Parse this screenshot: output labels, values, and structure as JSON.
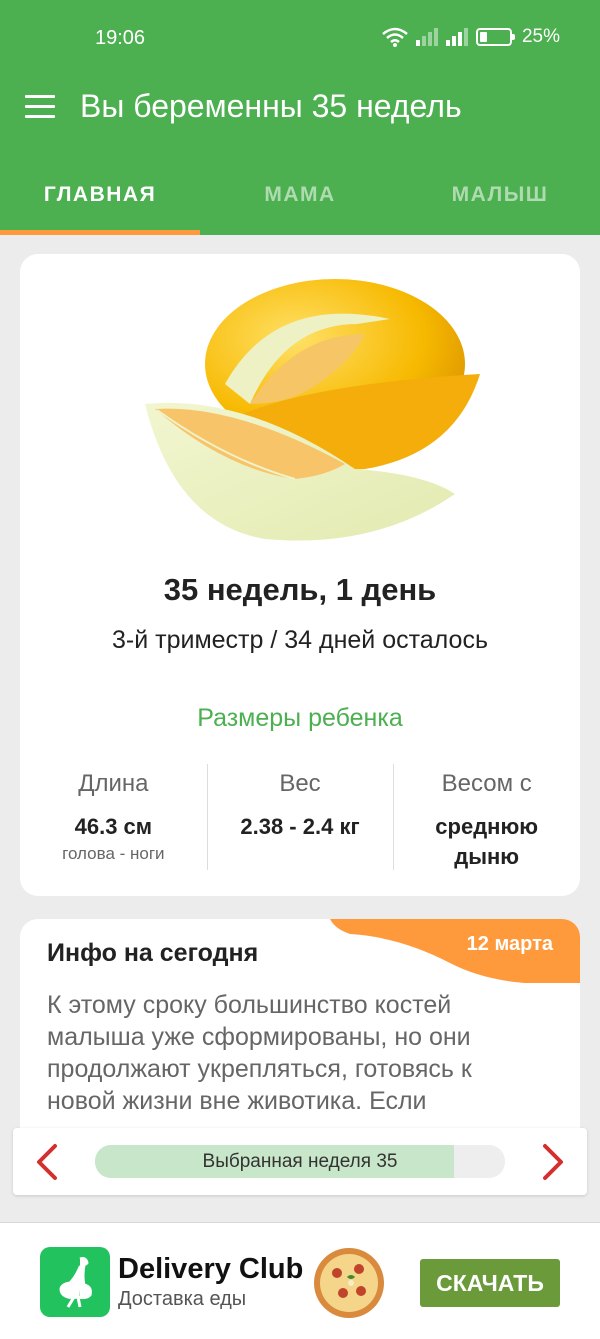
{
  "status_bar": {
    "time": "19:06",
    "battery": "25%",
    "battery_level": 0.25
  },
  "header": {
    "title": "Вы беременны 35 недель"
  },
  "tabs": [
    {
      "label": "ГЛАВНАЯ",
      "active": true
    },
    {
      "label": "МАМА",
      "active": false
    },
    {
      "label": "МАЛЫШ",
      "active": false
    }
  ],
  "summary": {
    "image": "honeydew-melon",
    "week_heading": "35 недель, 1 день",
    "trimester_line": "3-й триместр / 34 дней осталось",
    "sizes_title": "Размеры ребенка",
    "stats": [
      {
        "label": "Длина",
        "value": "46.3 см",
        "sub": "голова - ноги"
      },
      {
        "label": "Вес",
        "value": "2.38 - 2.4 кг",
        "sub": ""
      },
      {
        "label": "Весом с",
        "value": "среднюю дыню",
        "sub": ""
      }
    ]
  },
  "info": {
    "title": "Инфо на сегодня",
    "date": "12 марта",
    "text": "К этому сроку большинство костей малыша уже сформированы, но они продолжают укрепляться, готовясь к новой жизни вне животика. Если"
  },
  "week_selector": {
    "label": "Выбранная неделя 35",
    "progress": 0.875,
    "prev_icon": "chevron-left-icon",
    "next_icon": "chevron-right-icon"
  },
  "ad": {
    "title": "Delivery Club",
    "subtitle": "Доставка еды",
    "cta": "СКАЧАТЬ",
    "logo_icon": "ostrich-icon"
  },
  "colors": {
    "header": "#4caf50",
    "accent": "#ff9a3c",
    "arrow": "#d32f2f",
    "ad_cta": "#6a9a3a"
  }
}
